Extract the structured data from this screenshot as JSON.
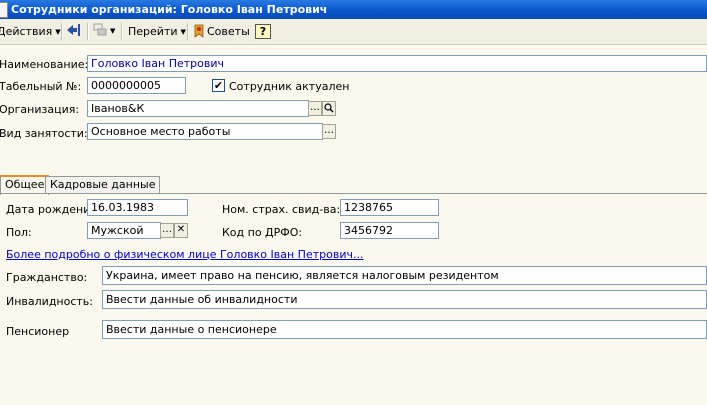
{
  "window": {
    "title": "Сотрудники организаций: Головко  Іван Петрович"
  },
  "toolbar": {
    "actions_label": "Действия",
    "goto_label": "Перейти",
    "tips_label": "Советы",
    "help_icon": "?"
  },
  "form": {
    "name_label": "Наименование:",
    "name_value": "Головко  Іван Петрович",
    "tab_num_label": "Табельный №:",
    "tab_num_value": "0000000005",
    "active_label": "Сотрудник актуален",
    "active_checked": "✔",
    "org_label": "Организация:",
    "org_value": "Іванов&К",
    "employment_label": "Вид занятости:",
    "employment_value": "Основное место работы"
  },
  "tabs": [
    {
      "label": "Общее"
    },
    {
      "label": "Кадровые данные"
    }
  ],
  "general": {
    "birth_label": "Дата рождения:",
    "birth_value": "16.03.1983",
    "insurance_label": "Ном. страх. свид-ва:",
    "insurance_value": "1238765",
    "gender_label": "Пол:",
    "gender_value": "Мужской",
    "drfo_label": "Код по ДРФО:",
    "drfo_value": "3456792",
    "more_link": "Более подробно о физическом лице Головко  Іван Петрович...",
    "citizenship_label": "Гражданство:",
    "citizenship_value": "Украина, имеет право на пенсию, является налоговым резидентом",
    "disability_label": "Инвалидность:",
    "disability_value": "Ввести данные об инвалидности",
    "pensioner_label": "Пенсионер",
    "pensioner_value": "Ввести данные о пенсионере"
  }
}
